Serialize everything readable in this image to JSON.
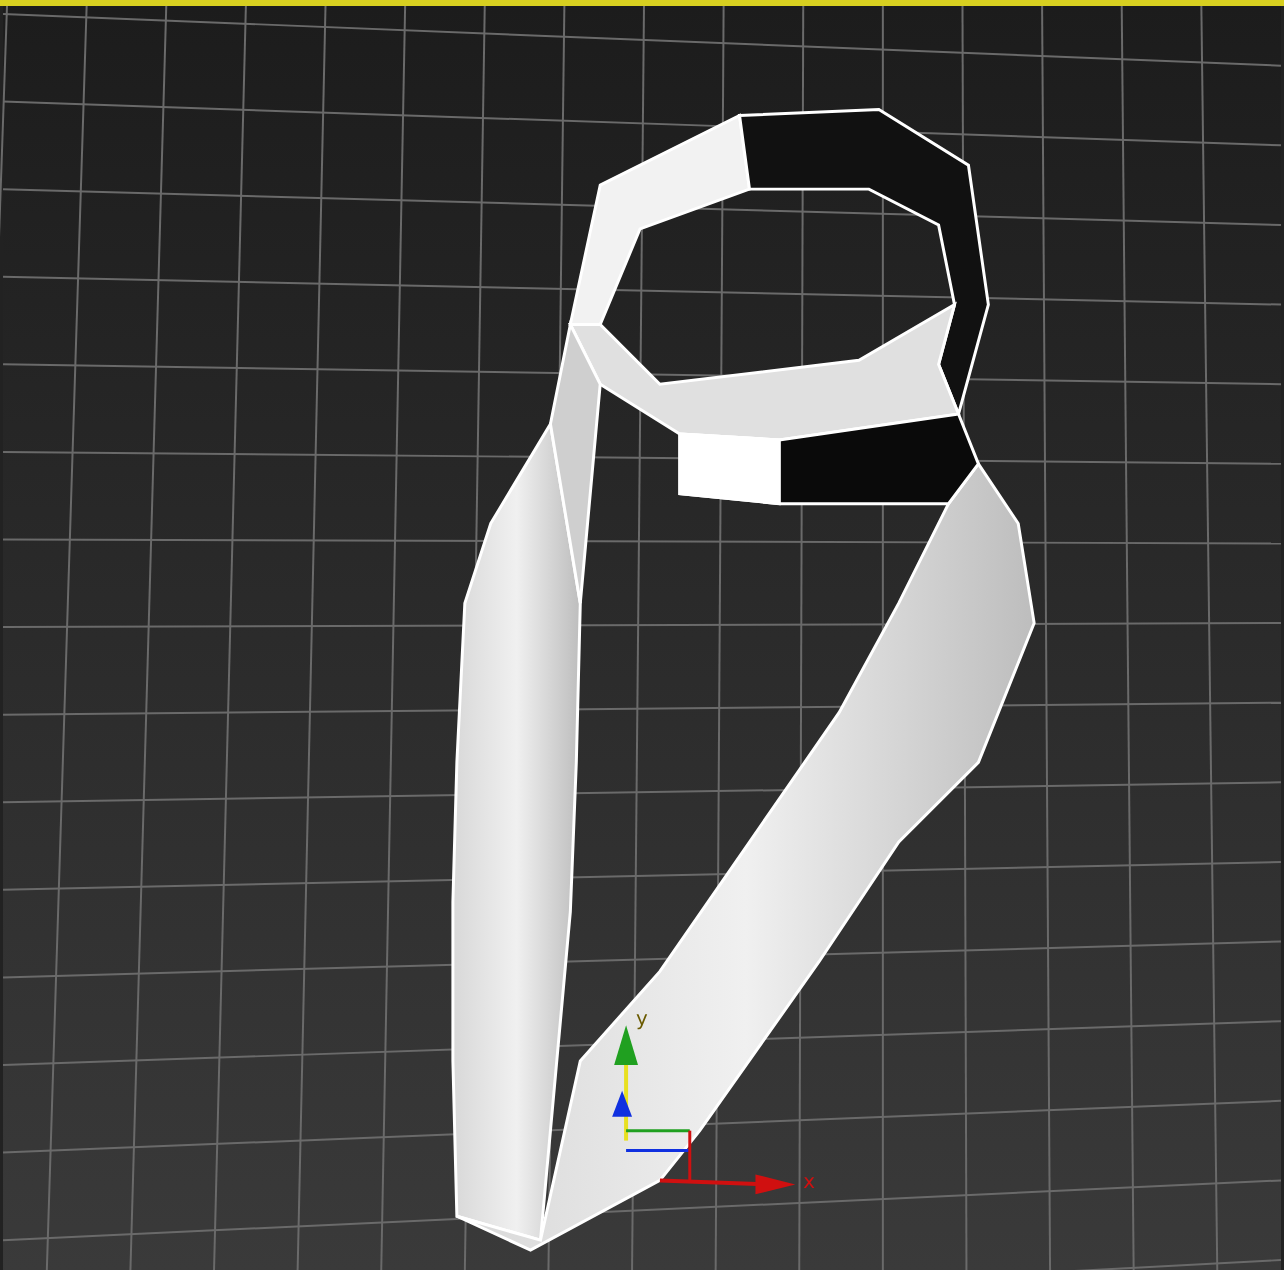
{
  "viewport": {
    "active": true
  },
  "gizmo": {
    "axes": [
      {
        "kind": "y",
        "label": "y"
      },
      {
        "kind": "x",
        "label": "x"
      }
    ]
  }
}
